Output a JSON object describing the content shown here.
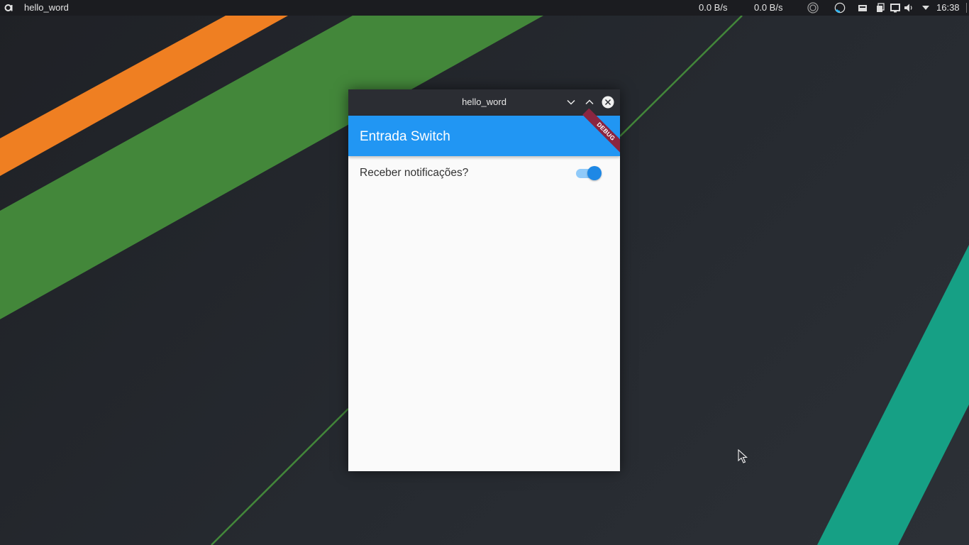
{
  "panel": {
    "active_app": "hello_word",
    "net_upload": "0.0 B/s",
    "net_download": "0.0 B/s",
    "clock": "16:38",
    "launcher_icon": "distro-launcher-icon",
    "tray_icons": [
      "circle-status-icon",
      "sync-icon",
      "storage-icon",
      "clipboard-icon",
      "display-icon",
      "volume-icon",
      "dropdown-arrow-icon"
    ]
  },
  "window": {
    "title": "hello_word",
    "controls": [
      "minimize-icon",
      "maximize-icon",
      "close-icon"
    ]
  },
  "app": {
    "appbar_title": "Entrada Switch",
    "debug_banner": "DEBUG",
    "switch_tile": {
      "label": "Receber notificações?",
      "value": true
    }
  },
  "colors": {
    "appbar": "#2196f3",
    "switch_thumb": "#1e88e5",
    "switch_track": "#90caf9",
    "debug_ribbon": "#8b2540",
    "wallpaper_orange": "#ef7f22",
    "wallpaper_green": "#43873a",
    "wallpaper_teal": "#16a085"
  }
}
